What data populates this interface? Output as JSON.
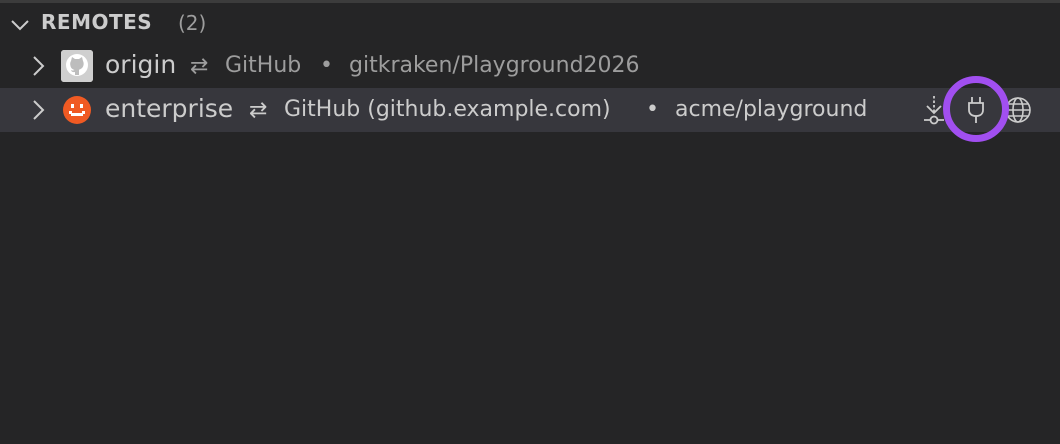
{
  "section": {
    "title": "REMOTES",
    "count": "(2)"
  },
  "remotes": [
    {
      "name": "origin",
      "provider": "GitHub",
      "separator": "•",
      "repo": "gitkraken/Playground2026",
      "sync_glyph": "⇄",
      "avatar_icon": "github-avatar-icon"
    },
    {
      "name": "enterprise",
      "provider": "GitHub (github.example.com)",
      "separator": "•",
      "repo": "acme/playground",
      "sync_glyph": "⇄",
      "avatar_icon": "identicon-avatar-icon",
      "actions": [
        "fetch-icon",
        "connect-plug-icon",
        "open-on-remote-globe-icon"
      ]
    }
  ],
  "colors": {
    "background": "#252526",
    "selected_row": "#37373d",
    "highlight_ring": "#a14ff0",
    "avatar_orange": "#f05a23"
  }
}
